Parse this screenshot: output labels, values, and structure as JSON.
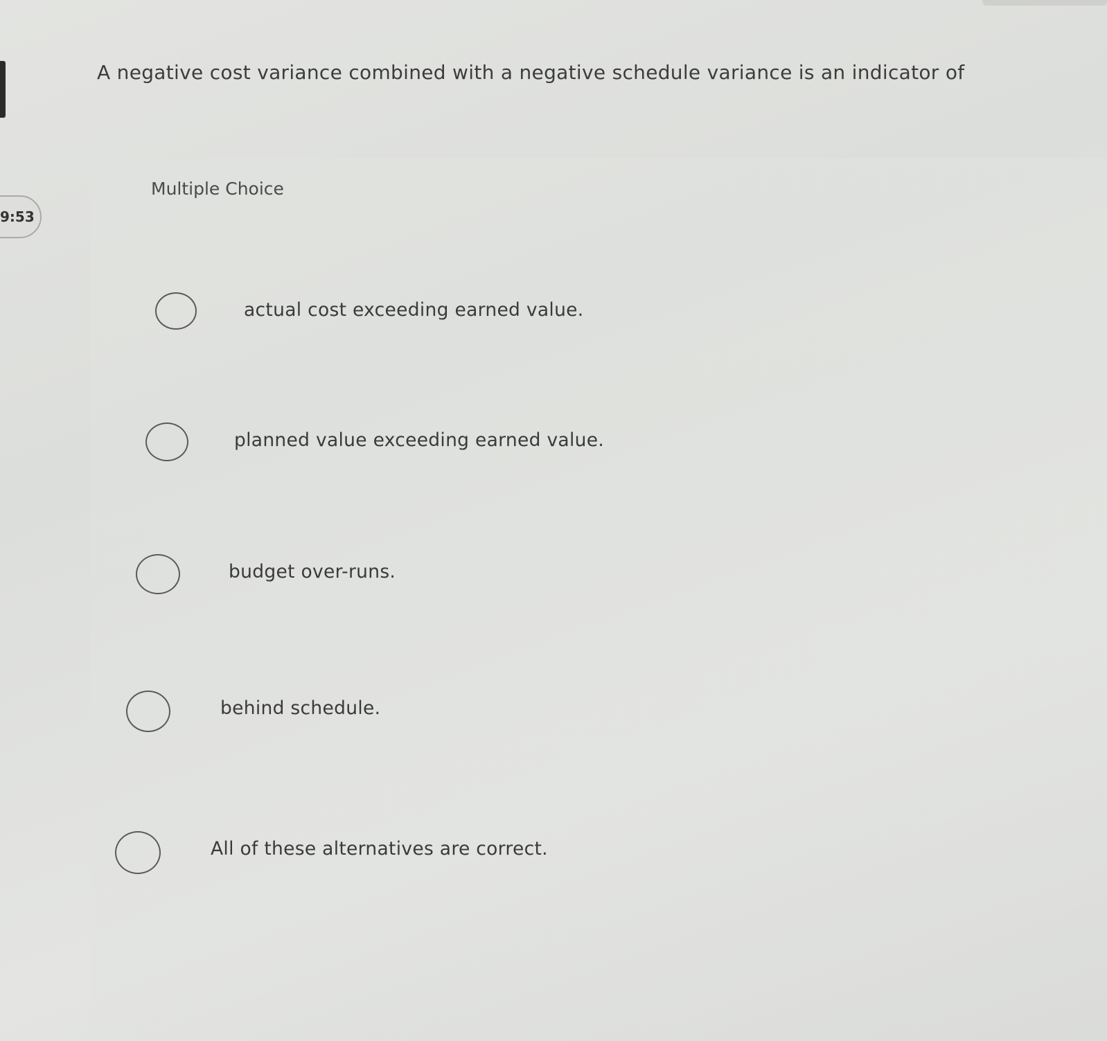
{
  "timer": {
    "text": "9:53"
  },
  "question": {
    "text": "A negative cost variance combined with a negative schedule variance is an indicator of"
  },
  "multiple_choice": {
    "label": "Multiple Choice",
    "options": [
      {
        "label": "actual cost exceeding earned value."
      },
      {
        "label": "planned value exceeding earned value."
      },
      {
        "label": "budget over-runs."
      },
      {
        "label": "behind schedule."
      },
      {
        "label": "All of these alternatives are correct."
      }
    ]
  }
}
